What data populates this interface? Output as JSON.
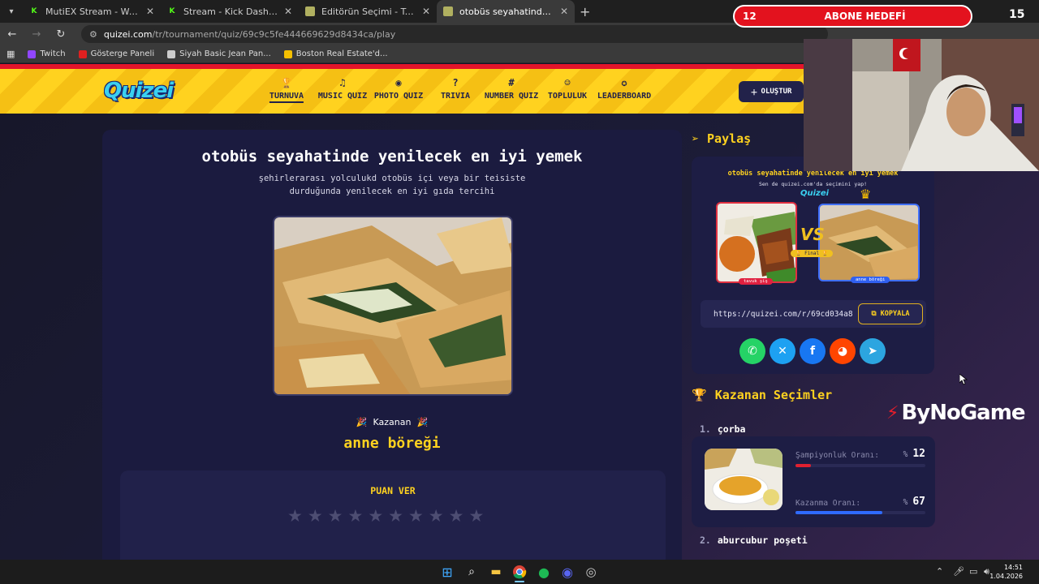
{
  "browser": {
    "tabs": [
      {
        "title": "MutiEX Stream - Watch Live on",
        "icon_color": "#53fc18",
        "icon_glyph": "K",
        "active": false
      },
      {
        "title": "Stream - Kick Dashboard",
        "icon_color": "#53fc18",
        "icon_glyph": "K",
        "active": false
      },
      {
        "title": "Editörün Seçimi - Turnuva - Qu",
        "icon_color": "#b0b060",
        "icon_glyph": "",
        "active": false
      },
      {
        "title": "otobüs seyahatinde yenilecek e",
        "icon_color": "#b0b060",
        "icon_glyph": "",
        "active": true
      }
    ],
    "url_host": "quizei.com",
    "url_path": "/tr/tournament/quiz/69c9c5fe444669629d8434ca/play",
    "bookmarks": [
      {
        "label": "Twitch",
        "icon_color": "#9146ff"
      },
      {
        "label": "Gösterge Paneli",
        "icon_color": "#e02020"
      },
      {
        "label": "Siyah Basic Jean Pan...",
        "icon_color": "#cccccc"
      },
      {
        "label": "Boston Real Estate'd...",
        "icon_color": "#f5c000"
      }
    ]
  },
  "site": {
    "logo": "Quizei",
    "nav": [
      {
        "label": "TURNUVA",
        "icon": "trophy-icon",
        "glyph": "🏆",
        "active": true
      },
      {
        "label": "MUSIC QUIZ",
        "icon": "music-icon",
        "glyph": "♫",
        "active": false
      },
      {
        "label": "PHOTO QUIZ",
        "icon": "camera-icon",
        "glyph": "◉",
        "active": false
      },
      {
        "label": "TRIVIA",
        "icon": "question-icon",
        "glyph": "?",
        "active": false
      },
      {
        "label": "NUMBER QUIZ",
        "icon": "hash-icon",
        "glyph": "#",
        "active": false
      },
      {
        "label": "TOPLULUK",
        "icon": "users-icon",
        "glyph": "☺",
        "active": false
      },
      {
        "label": "LEADERBOARD",
        "icon": "award-icon",
        "glyph": "✪",
        "active": false
      }
    ],
    "create_label": "OLUŞTUR"
  },
  "quiz": {
    "title": "otobüs seyahatinde yenilecek en iyi yemek",
    "subtitle": "şehirlerarası yolculukd otobüs içi veya bir teisiste durduğunda yenilecek en iyi gıda tercihi",
    "winner_label": "Kazanan",
    "winner_name": "anne böreği",
    "rate_title": "PUAN VER",
    "star_count": 10
  },
  "share": {
    "heading": "Paylaş",
    "card_title": "otobüs seyahatinde yenilecek en iyi yemek",
    "card_sub": "Sen de quizei.com'da seçimini yap!",
    "card_logo": "Quizei",
    "vs": "VS",
    "final_label": "🏆 Final 🏆",
    "left_tag": "tavuk şiş",
    "right_tag": "anne böreği",
    "link": "https://quizei.com/r/69cd034a8",
    "copy_label": "KOPYALA",
    "socials": [
      {
        "name": "whatsapp-icon",
        "color": "#25d366",
        "glyph": "✆"
      },
      {
        "name": "x-icon",
        "color": "#1da1f2",
        "glyph": "✕"
      },
      {
        "name": "facebook-icon",
        "color": "#1877f2",
        "glyph": "f"
      },
      {
        "name": "reddit-icon",
        "color": "#ff4500",
        "glyph": "◕"
      },
      {
        "name": "telegram-icon",
        "color": "#2ca5e0",
        "glyph": "➤"
      }
    ]
  },
  "winners": {
    "heading": "Kazanan Seçimler",
    "items": [
      {
        "rank": "1.",
        "name": "çorba",
        "champ_label": "Şampiyonluk Oranı:",
        "champ_value": 12,
        "win_label": "Kazanma Oranı:",
        "win_value": 67
      },
      {
        "rank": "2.",
        "name": "aburcubur poşeti"
      }
    ],
    "pct_symbol": "%",
    "champ_color": "#e02030",
    "win_color": "#2f6bff"
  },
  "overlay": {
    "sub_goal_current": "12",
    "sub_goal_label": "ABONE HEDEFİ",
    "sub_goal_target": "15",
    "sponsor": "ByNoGame"
  },
  "taskbar": {
    "time": "14:51",
    "date": "1.04.2026"
  }
}
